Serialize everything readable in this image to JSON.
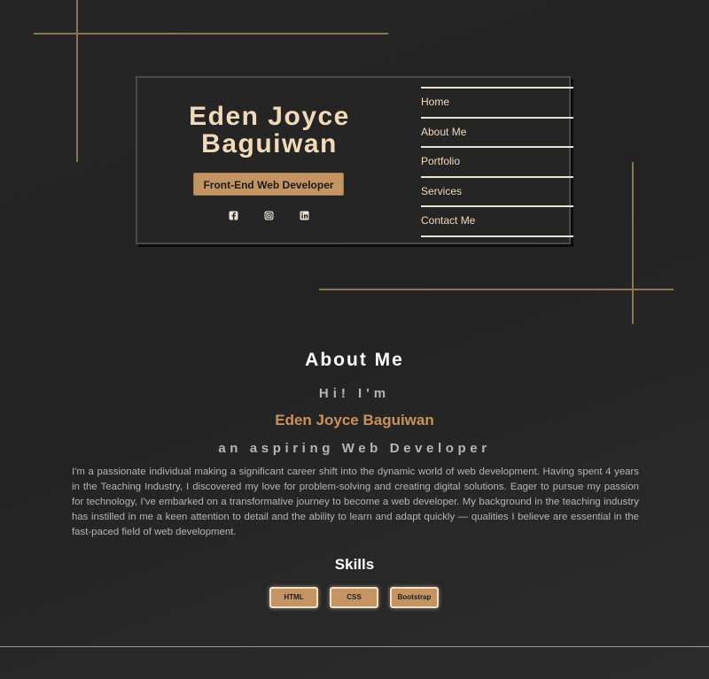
{
  "colors": {
    "background": "#252525",
    "accent": "#c49562",
    "accent_text": "#f1dab8",
    "decor_line": "#8b7553"
  },
  "hero": {
    "name": "Eden Joyce Baguiwan",
    "role": "Front-End Web Developer",
    "social": [
      "facebook-icon",
      "instagram-icon",
      "linkedin-icon"
    ]
  },
  "nav": {
    "items": [
      {
        "label": "Home"
      },
      {
        "label": "About Me"
      },
      {
        "label": "Portfolio"
      },
      {
        "label": "Services"
      },
      {
        "label": "Contact Me"
      }
    ]
  },
  "about": {
    "title": "About Me",
    "greeting": "Hi! I'm",
    "name": "Eden Joyce Baguiwan",
    "tagline": "an aspiring Web Developer",
    "bio": "I'm a passionate individual making a significant career shift into the dynamic world of web development. Having spent 4 years in the Teaching Industry, I discovered my love for problem-solving and creating digital solutions. Eager to pursue my passion for technology, I've embarked on a transformative journey to become a web developer. My background in the teaching industry has instilled in me a keen attention to detail and the ability to learn and adapt quickly — qualities I believe are essential in the fast-paced field of web development."
  },
  "skills": {
    "title": "Skills",
    "items": [
      {
        "label": "HTML"
      },
      {
        "label": "CSS"
      },
      {
        "label": "Bootstrap"
      }
    ]
  }
}
